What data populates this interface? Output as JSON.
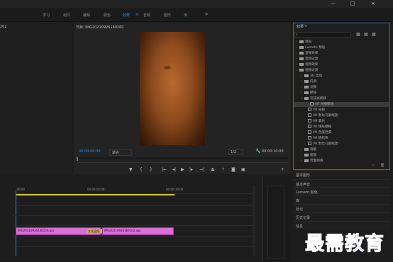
{
  "window": {
    "minimize": "—",
    "maximize": "□",
    "close": "×"
  },
  "workspaces": {
    "tabs": [
      "学习",
      "组件",
      "编辑",
      "颜色",
      "效果",
      "音频",
      "图形",
      "库"
    ],
    "active_index": 4,
    "more": "»",
    "menu_icon": "≡"
  },
  "left_panel": {
    "label": "202"
  },
  "program_monitor": {
    "title": "节目: IMG20210926160202",
    "menu_icon": "≡",
    "current_time": "00:00:00:00",
    "fit": "适合",
    "resolution": "1/2",
    "duration": "00:00:10:00",
    "frame_label": "frame-wood-texture"
  },
  "playback_controls": [
    "marker-icon",
    "mark-in-icon",
    "mark-out-icon",
    "go-to-in-icon",
    "step-back-icon",
    "play-icon",
    "step-forward-icon",
    "go-to-out-icon",
    "lift-icon",
    "extract-icon",
    "export-frame-icon",
    "compare-icon"
  ],
  "effects_panel": {
    "title": "效果",
    "menu_icon": "≡",
    "items": [
      {
        "label": "预设",
        "level": 0,
        "kind": "folder"
      },
      {
        "label": "Lumetri 预设",
        "level": 0,
        "kind": "folder"
      },
      {
        "label": "音频效果",
        "level": 0,
        "kind": "folder"
      },
      {
        "label": "音频过渡",
        "level": 0,
        "kind": "folder"
      },
      {
        "label": "视频效果",
        "level": 0,
        "kind": "folder"
      },
      {
        "label": "视频过渡",
        "level": 0,
        "kind": "folder",
        "open": true
      },
      {
        "label": "3D 运动",
        "level": 1,
        "kind": "folder"
      },
      {
        "label": "内滑",
        "level": 1,
        "kind": "folder"
      },
      {
        "label": "划像",
        "level": 1,
        "kind": "folder"
      },
      {
        "label": "擦除",
        "level": 1,
        "kind": "folder"
      },
      {
        "label": "沉浸式视频",
        "level": 1,
        "kind": "folder",
        "open": true
      },
      {
        "label": "VR 光圈擦除",
        "level": 2,
        "kind": "fx",
        "selected": true
      },
      {
        "label": "VR 光线",
        "level": 2,
        "kind": "fx"
      },
      {
        "label": "VR 默比乌斯缩放",
        "level": 2,
        "kind": "fx"
      },
      {
        "label": "VR 漏光",
        "level": 2,
        "kind": "fx"
      },
      {
        "label": "VR 球形模糊",
        "level": 2,
        "kind": "fx"
      },
      {
        "label": "VR 色度泄漏",
        "level": 2,
        "kind": "fx"
      },
      {
        "label": "VR 随机块",
        "level": 2,
        "kind": "fx"
      },
      {
        "label": "VR 默比乌斯缩放",
        "level": 2,
        "kind": "fx"
      },
      {
        "label": "溶解",
        "level": 1,
        "kind": "folder"
      },
      {
        "label": "缩放",
        "level": 1,
        "kind": "folder"
      },
      {
        "label": "页面剥落",
        "level": 1,
        "kind": "folder"
      }
    ]
  },
  "side_panels": [
    "基本图形",
    "基本声音",
    "Lumetri 颜色",
    "库",
    "标记",
    "历史记录",
    "信息"
  ],
  "timeline": {
    "ruler": [
      "-00:00",
      "00:00:05:00",
      "00:00:10:00"
    ],
    "clips": [
      {
        "name": "IMG20210926160156.jpg"
      },
      {
        "name": "IMG20210926160202.jpg"
      }
    ],
    "transition": "叉化显隐"
  },
  "watermark": "最需教育"
}
